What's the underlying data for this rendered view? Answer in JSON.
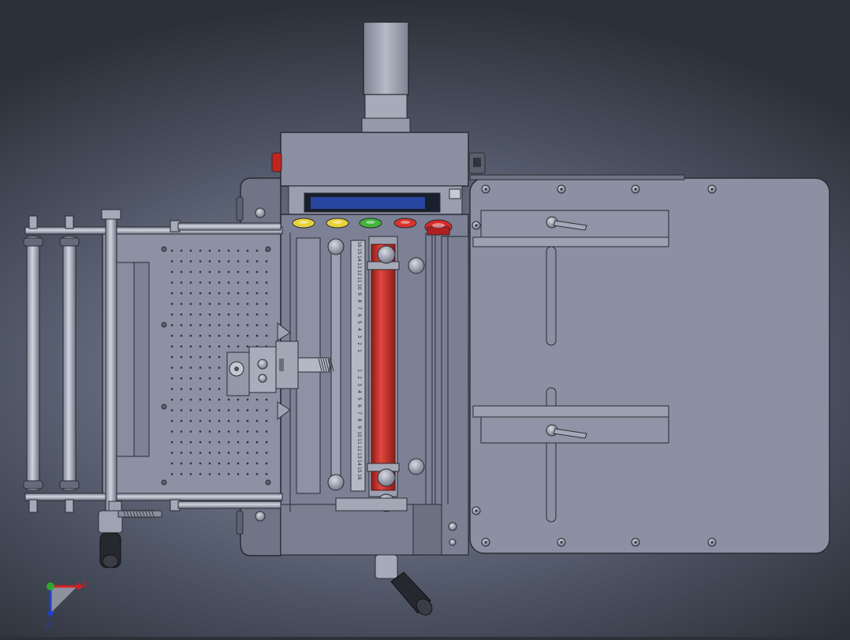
{
  "viewport": {
    "title": "",
    "background_top": "#2c3038",
    "background_center": "#8a93a6"
  },
  "model": {
    "frame_color": "#7c8196",
    "table_color": "#8b90a3",
    "steel_color": "#9ea3b3",
    "roller_color": "#c8352e",
    "display_color": "#1e3a8a",
    "buttons": [
      {
        "name": "button-yellow-1",
        "color": "#e8d23a"
      },
      {
        "name": "button-yellow-2",
        "color": "#e8d23a"
      },
      {
        "name": "button-green",
        "color": "#3fb53a"
      },
      {
        "name": "button-red",
        "color": "#d8342e"
      },
      {
        "name": "button-emergency-stop",
        "color": "#d82a2a"
      }
    ],
    "scale_labels_top": [
      "16",
      "15",
      "14",
      "13",
      "12",
      "11",
      "10",
      "9",
      "8",
      "7",
      "6",
      "5",
      "4",
      "3",
      "2",
      "1"
    ],
    "scale_labels_bottom": [
      "1",
      "2",
      "3",
      "4",
      "5",
      "6",
      "7",
      "8",
      "9",
      "10",
      "11",
      "12",
      "13",
      "14",
      "15",
      "16"
    ],
    "handles": [
      "crank-handle-left",
      "crank-handle-bottom",
      "clamp-lever-top",
      "clamp-lever-bottom"
    ]
  },
  "triad": {
    "x_label": "X",
    "z_label": "Z",
    "x_color": "#d42020",
    "y_color": "#2fa82f",
    "z_color": "#2040c8"
  }
}
